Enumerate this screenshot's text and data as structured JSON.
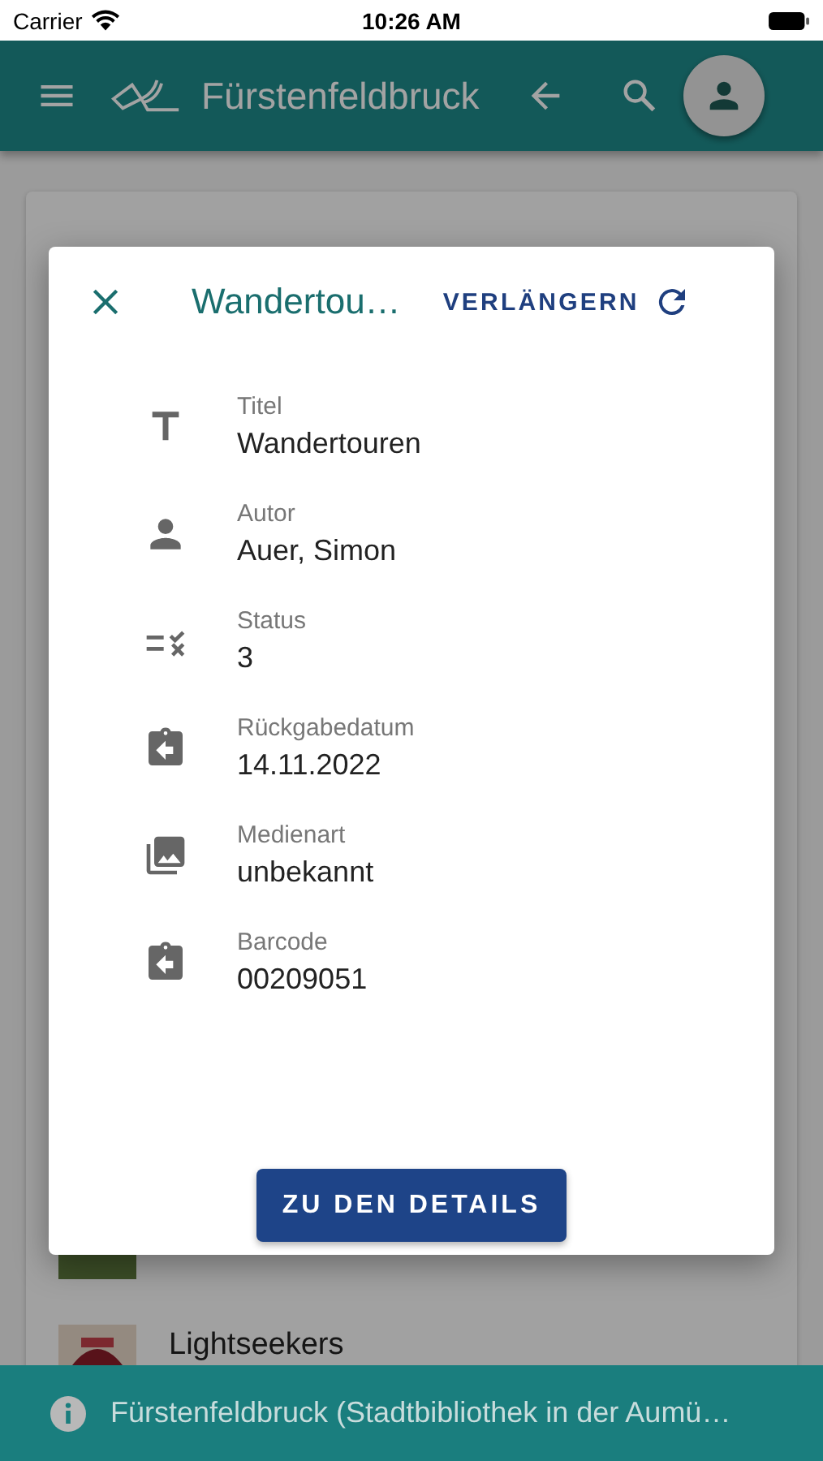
{
  "status_bar": {
    "carrier": "Carrier",
    "time": "10:26 AM"
  },
  "app_bar": {
    "title": "Fürstenfeldbruck"
  },
  "background_list": [
    {
      "thumbnail": {
        "kind": "picture"
      }
    },
    {
      "thumbnail": {
        "kind": "picture"
      },
      "title": "Lightseekers"
    }
  ],
  "dialog": {
    "title": "Wandertou…",
    "action": "VERLÄNGERN",
    "fields": [
      {
        "kind": "title",
        "label": "Titel",
        "value": "Wandertouren"
      },
      {
        "kind": "person",
        "label": "Autor",
        "value": "Auer, Simon"
      },
      {
        "kind": "status",
        "label": "Status",
        "value": "3"
      },
      {
        "kind": "clipboard",
        "label": "Rückgabedatum",
        "value": "14.11.2022"
      },
      {
        "kind": "media",
        "label": "Medienart",
        "value": "unbekannt"
      },
      {
        "kind": "clipboard",
        "label": "Barcode",
        "value": "00209051"
      }
    ],
    "button": "ZU DEN DETAILS"
  },
  "snackbar": {
    "text": "Fürstenfeldbruck (Stadtbibliothek in der Aumü…"
  }
}
